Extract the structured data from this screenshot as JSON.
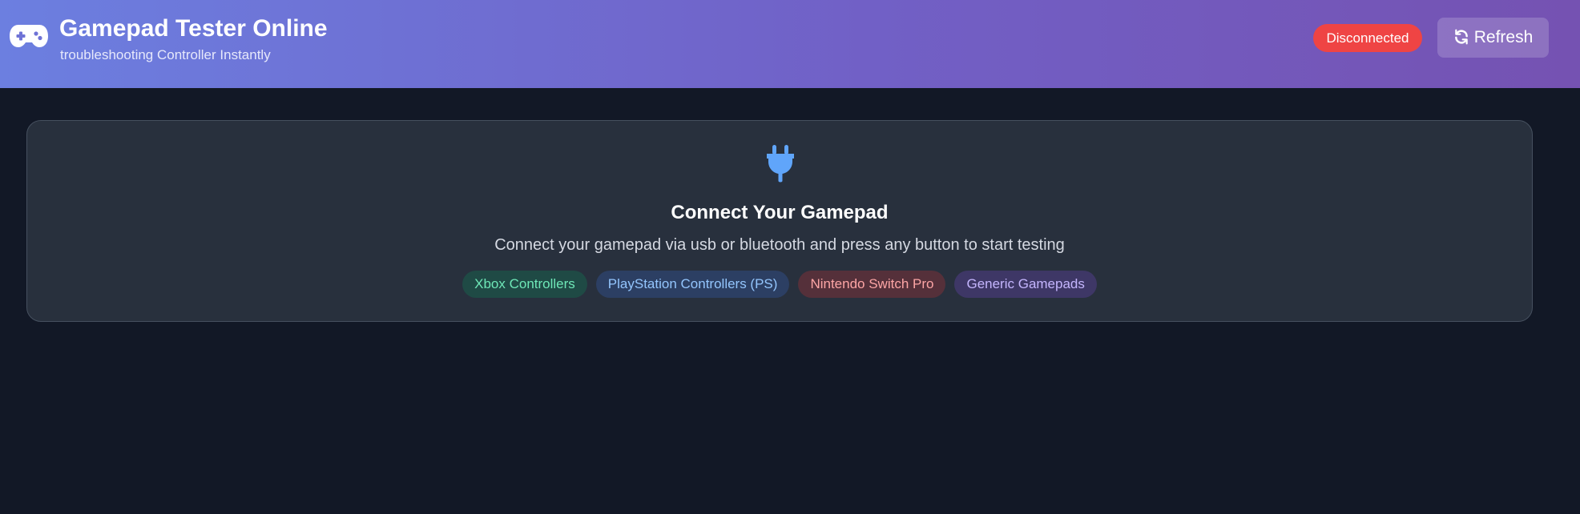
{
  "header": {
    "logo_icon": "gamepad-icon",
    "title": "Gamepad Tester Online",
    "subtitle": "troubleshooting Controller Instantly",
    "status": {
      "label": "Disconnected",
      "color": "#ef4444"
    },
    "refresh": {
      "icon": "refresh-icon",
      "label": "Refresh"
    }
  },
  "main": {
    "icon": "plug-icon",
    "icon_color": "#60a5fa",
    "title": "Connect Your Gamepad",
    "description": "Connect your gamepad via usb or bluetooth and press any button to start testing",
    "chips": [
      {
        "label": "Xbox Controllers",
        "text_color": "#6ee7b7",
        "bg_color": "#1f4a45"
      },
      {
        "label": "PlayStation Controllers (PS)",
        "text_color": "#93c5fd",
        "bg_color": "#2c3f63"
      },
      {
        "label": "Nintendo Switch Pro",
        "text_color": "#fca5a5",
        "bg_color": "#55303a"
      },
      {
        "label": "Generic Gamepads",
        "text_color": "#c4b5fd",
        "bg_color": "#3e3766"
      }
    ]
  }
}
